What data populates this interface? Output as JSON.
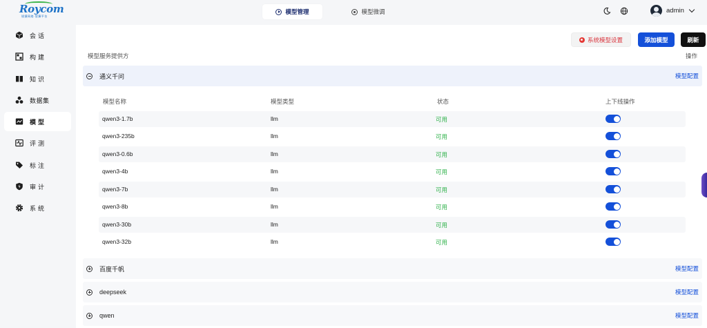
{
  "brand": {
    "logo_text": "Roycom",
    "logo_sub": "锐捷网络·智算平台"
  },
  "header": {
    "tabs": [
      {
        "label": "模型管理",
        "active": true,
        "icon": "play-circle-icon"
      },
      {
        "label": "模型微调",
        "active": false,
        "icon": "dot-circle-icon"
      }
    ],
    "icons": [
      "moon-icon",
      "globe-icon"
    ],
    "user": {
      "name": "admin"
    }
  },
  "sidebar": {
    "items": [
      {
        "label": "会话",
        "icon": "cube-icon",
        "active": false
      },
      {
        "label": "构建",
        "icon": "build-icon",
        "active": false
      },
      {
        "label": "知识",
        "icon": "book-icon",
        "active": false
      },
      {
        "label": "数据集",
        "icon": "dataset-icon",
        "active": false
      },
      {
        "label": "模型",
        "icon": "model-icon",
        "active": true
      },
      {
        "label": "评测",
        "icon": "pulse-icon",
        "active": false
      },
      {
        "label": "标注",
        "icon": "tag-icon",
        "active": false
      },
      {
        "label": "审计",
        "icon": "shield-icon",
        "active": false
      },
      {
        "label": "系统",
        "icon": "gear-icon",
        "active": false
      }
    ]
  },
  "toolbar": {
    "system_settings_label": "系统模型设置",
    "add_model_label": "添加模型",
    "refresh_label": "刷新"
  },
  "table": {
    "provider_header": "模型服务提供方",
    "operation_header": "操作",
    "config_label": "模型配置",
    "columns": [
      "模型名称",
      "模型类型",
      "状态",
      "上下线操作"
    ],
    "providers": [
      {
        "name": "通义千问",
        "expanded": true,
        "models": [
          {
            "name": "qwen3-1.7b",
            "type": "llm",
            "status": "可用",
            "online": true
          },
          {
            "name": "qwen3-235b",
            "type": "llm",
            "status": "可用",
            "online": true
          },
          {
            "name": "qwen3-0.6b",
            "type": "llm",
            "status": "可用",
            "online": true
          },
          {
            "name": "qwen3-4b",
            "type": "llm",
            "status": "可用",
            "online": true
          },
          {
            "name": "qwen3-7b",
            "type": "llm",
            "status": "可用",
            "online": true
          },
          {
            "name": "qwen3-8b",
            "type": "llm",
            "status": "可用",
            "online": true
          },
          {
            "name": "qwen3-30b",
            "type": "llm",
            "status": "可用",
            "online": true
          },
          {
            "name": "qwen3-32b",
            "type": "llm",
            "status": "可用",
            "online": true
          }
        ]
      },
      {
        "name": "百度千帆",
        "expanded": false
      },
      {
        "name": "deepseek",
        "expanded": false
      },
      {
        "name": "qwen",
        "expanded": false
      }
    ]
  },
  "colors": {
    "primary": "#1450d9",
    "status_ok": "#2fb14a",
    "danger": "#d9363e"
  }
}
